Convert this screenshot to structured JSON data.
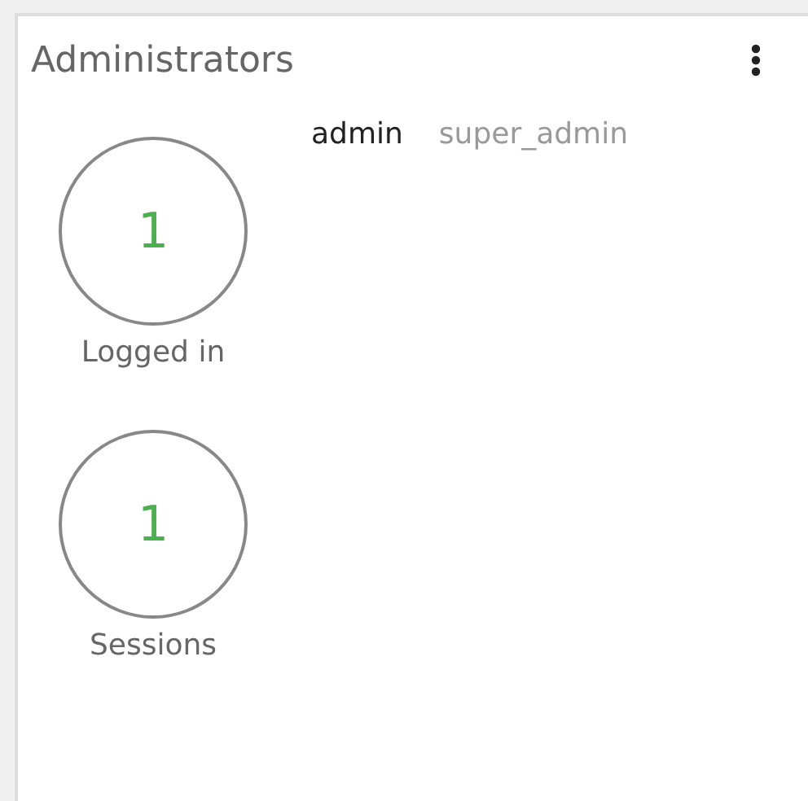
{
  "panel": {
    "title": "Administrators"
  },
  "stats": [
    {
      "value": "1",
      "label": "Logged in"
    },
    {
      "value": "1",
      "label": "Sessions"
    }
  ],
  "admins": [
    {
      "name": "admin",
      "role": "super_admin"
    }
  ]
}
